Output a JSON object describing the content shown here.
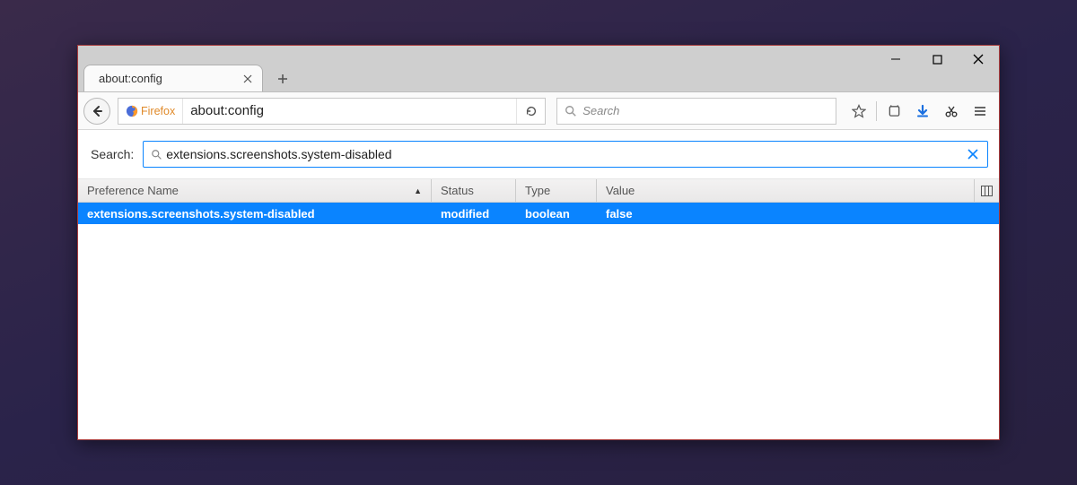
{
  "window": {
    "title": "about:config"
  },
  "tab": {
    "title": "about:config"
  },
  "nav": {
    "identity_label": "Firefox",
    "url": "about:config",
    "search_placeholder": "Search"
  },
  "config": {
    "search_label": "Search:",
    "search_value": "extensions.screenshots.system-disabled",
    "columns": {
      "name": "Preference Name",
      "status": "Status",
      "type": "Type",
      "value": "Value"
    },
    "rows": [
      {
        "name": "extensions.screenshots.system-disabled",
        "status": "modified",
        "type": "boolean",
        "value": "false",
        "selected": true
      }
    ]
  }
}
